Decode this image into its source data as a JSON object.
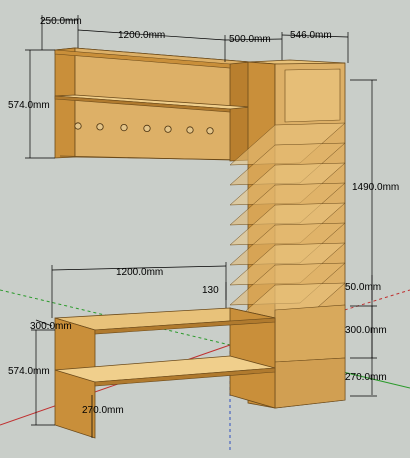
{
  "model": {
    "name": "wardrobe-hallway-set",
    "wood_fill": "#ddb067",
    "wood_side": "#c98f3a",
    "wood_dark": "#a8712a",
    "edge_color": "#6b4a1a",
    "background": "#c9cec9"
  },
  "dimensions": {
    "top_shelf_depth": "250.0mm",
    "top_shelf_width": "1200.0mm",
    "top_gap": "500.0mm",
    "tower_width": "546.0mm",
    "top_shelf_height": "574.0mm",
    "tower_height": "1490.0mm",
    "bench_width": "1200.0mm",
    "bench_offset": "130",
    "bench_depth": "300.0mm",
    "bench_height": "574.0mm",
    "tower_drawer_height": "50.0mm",
    "tower_lower_shelf": "300.0mm",
    "tower_plinth": "270.0mm",
    "bench_plinth": "270.0mm"
  }
}
